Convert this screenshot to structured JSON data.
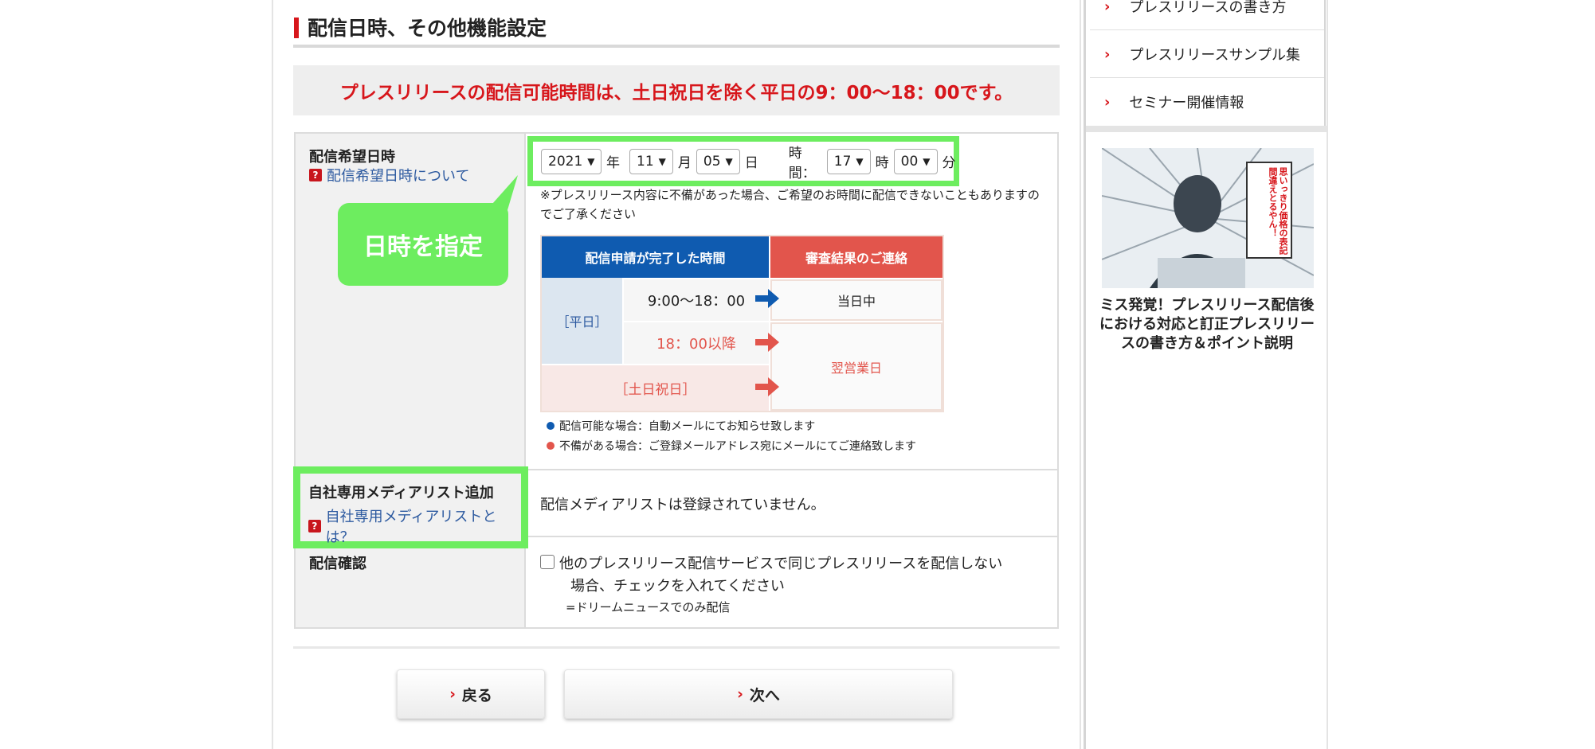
{
  "section_title": "配信日時、その他機能設定",
  "notice": "プレスリリースの配信可能時間は、土日祝日を除く平日の9：00〜18：00です。",
  "schedule": {
    "label": "配信希望日時",
    "help": "配信希望日時について",
    "year": "2021",
    "year_unit": "年",
    "month": "11",
    "month_unit": "月",
    "day": "05",
    "day_unit": "日",
    "time_label": "時間：",
    "hour": "17",
    "hour_unit": "時",
    "minute": "00",
    "minute_unit": "分",
    "note": "※プレスリリース内容に不備があった場合、ご希望のお時間に配信できないこともありますのでご了承ください",
    "callout": "日時を指定"
  },
  "flow_table": {
    "header_left": "配信申請が完了した時間",
    "header_right": "審査結果のご連絡",
    "weekday": "［平日］",
    "time1": "9:00〜18：00",
    "time2": "18：00以降",
    "holiday": "［土日祝日］",
    "result_same_day": "当日中",
    "result_next_day": "翌営業日",
    "legend_blue": "配信可能な場合：自動メールにてお知らせ致します",
    "legend_red": "不備がある場合：ご登録メールアドレス宛にメールにてご連絡致します"
  },
  "media": {
    "label": "自社専用メディアリスト追加",
    "help": "自社専用メディアリストとは？",
    "value": "配信メディアリストは登録されていません。"
  },
  "confirm": {
    "label": "配信確認",
    "checkbox_line1": "他のプレスリリース配信サービスで同じプレスリリースを配信しない",
    "checkbox_line2": "場合、チェックを入れてください",
    "sub": "=ドリームニュースでのみ配信"
  },
  "buttons": {
    "back": "戻る",
    "next": "次へ"
  },
  "sidebar": {
    "items": [
      "プレスリリースの書き方",
      "プレスリリースサンプル集",
      "セミナー開催情報"
    ],
    "thumb_text": "思いっきり価格の表記間違えとるやん！",
    "article_title": "ミス発覚！プレスリリース配信後における対応と訂正プレスリリースの書き方＆ポイント説明"
  },
  "colors": {
    "accent_red": "#d7161b",
    "highlight_green": "#6ded5f",
    "link_blue": "#2d5aa0",
    "header_blue": "#0f5bb0",
    "header_red": "#e2554c"
  }
}
